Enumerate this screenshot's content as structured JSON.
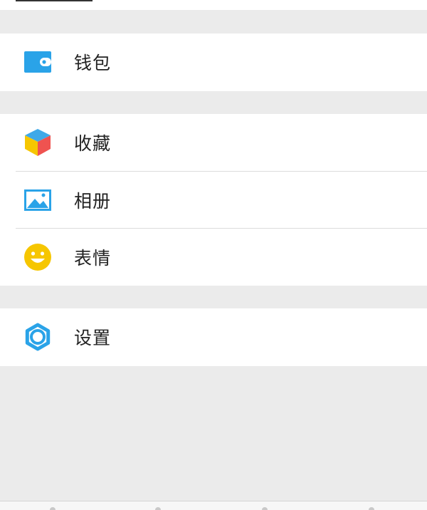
{
  "menu": {
    "wallet": {
      "label": "钱包",
      "icon": "wallet-icon",
      "color": "#2aa3e8"
    },
    "favorites": {
      "label": "收藏",
      "icon": "favorites-cube-icon"
    },
    "album": {
      "label": "相册",
      "icon": "album-image-icon",
      "color": "#2aa3e8"
    },
    "stickers": {
      "label": "表情",
      "icon": "smiley-icon",
      "color": "#f6c600"
    },
    "settings": {
      "label": "设置",
      "icon": "gear-icon",
      "color": "#2aa3e8"
    }
  },
  "colors": {
    "background": "#ebebeb",
    "card": "#ffffff",
    "divider": "#dcdcdc",
    "text": "#222222"
  }
}
